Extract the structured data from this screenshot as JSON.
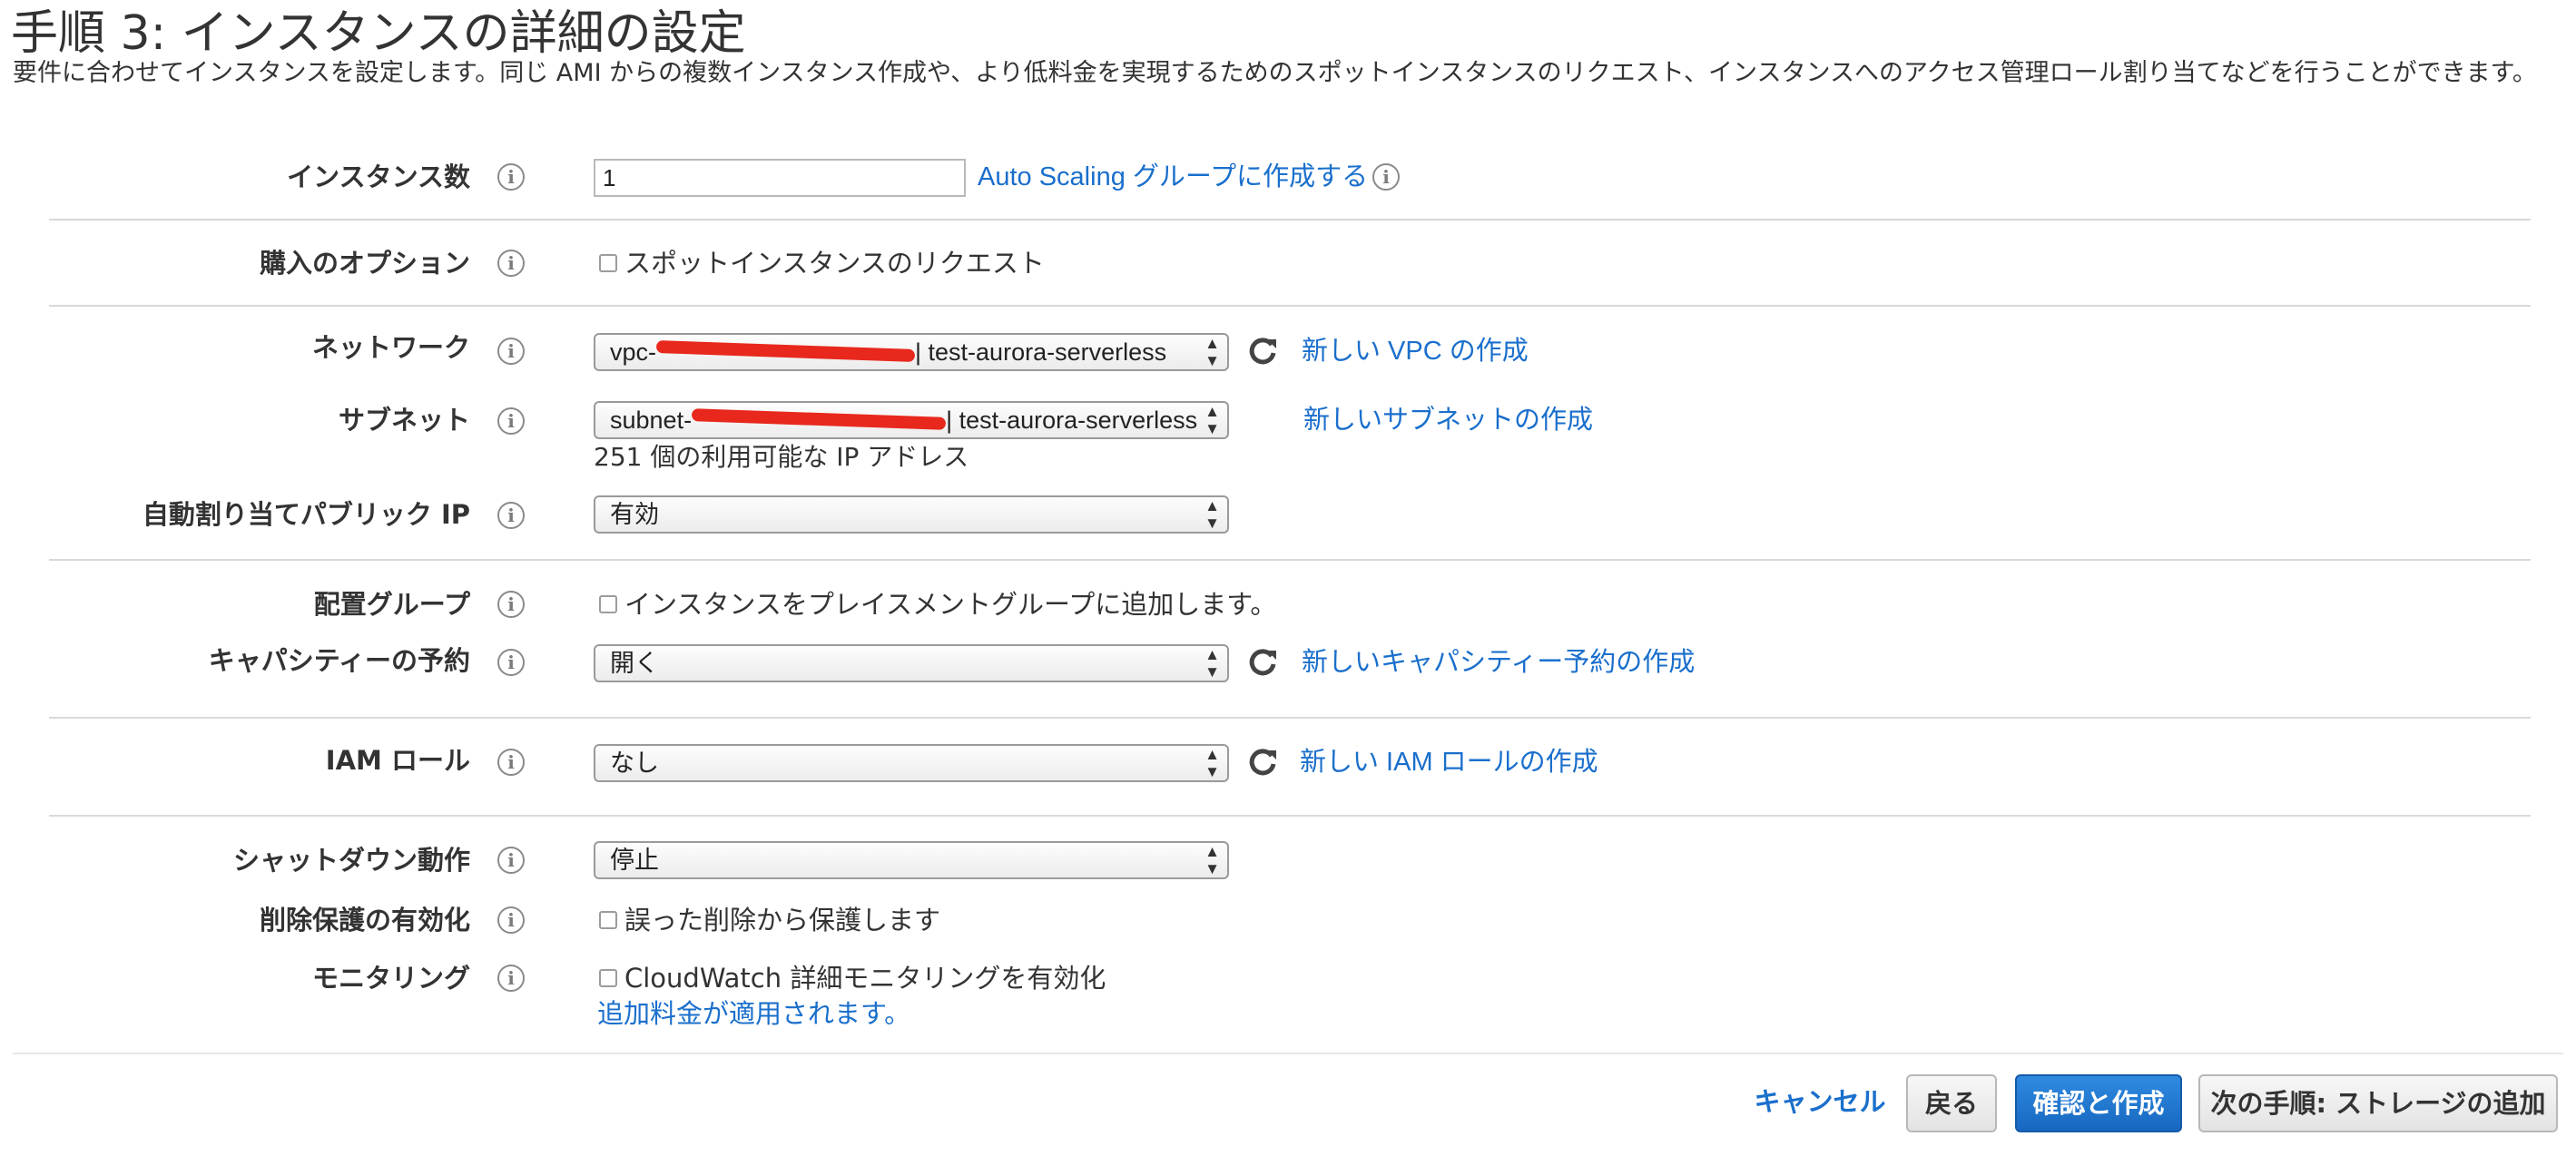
{
  "page": {
    "title": "手順 3: インスタンスの詳細の設定",
    "description": "要件に合わせてインスタンスを設定します。同じ AMI からの複数インスタンス作成や、より低料金を実現するためのスポットインスタンスのリクエスト、インスタンスへのアクセス管理ロール割り当てなどを行うことができます。"
  },
  "icons": {
    "info": "info-icon",
    "refresh": "refresh-icon",
    "select_arrows": "select-arrows-icon"
  },
  "colors": {
    "link": "#1a6fcc",
    "primary_button": "#1767c0",
    "redaction": "#e8281c"
  },
  "fields": {
    "instance_count": {
      "label": "インスタンス数",
      "value": "1",
      "link": "Auto Scaling グループに作成する"
    },
    "purchase_option": {
      "label": "購入のオプション",
      "checkbox_label": "スポットインスタンスのリクエスト",
      "checked": false
    },
    "network": {
      "label": "ネットワーク",
      "value_prefix": "vpc-",
      "value_suffix": "| test-aurora-serverless",
      "link": "新しい VPC の作成"
    },
    "subnet": {
      "label": "サブネット",
      "value_prefix": "subnet-",
      "value_suffix": "| test-aurora-serverless",
      "link": "新しいサブネットの作成",
      "available_ips": "251 個の利用可能な IP アドレス"
    },
    "public_ip": {
      "label": "自動割り当てパブリック IP",
      "value": "有効"
    },
    "placement_group": {
      "label": "配置グループ",
      "checkbox_label": "インスタンスをプレイスメントグループに追加します。",
      "checked": false
    },
    "capacity_reservation": {
      "label": "キャパシティーの予約",
      "value": "開く",
      "link": "新しいキャパシティー予約の作成"
    },
    "iam_role": {
      "label": "IAM ロール",
      "value": "なし",
      "link": "新しい IAM ロールの作成"
    },
    "shutdown_behavior": {
      "label": "シャットダウン動作",
      "value": "停止"
    },
    "termination_protection": {
      "label": "削除保護の有効化",
      "checkbox_label": "誤った削除から保護します",
      "checked": false
    },
    "monitoring": {
      "label": "モニタリング",
      "checkbox_label": "CloudWatch 詳細モニタリングを有効化",
      "checked": false,
      "note": "追加料金が適用されます。"
    }
  },
  "footer": {
    "cancel": "キャンセル",
    "back": "戻る",
    "review_launch": "確認と作成",
    "next": "次の手順: ストレージの追加"
  }
}
